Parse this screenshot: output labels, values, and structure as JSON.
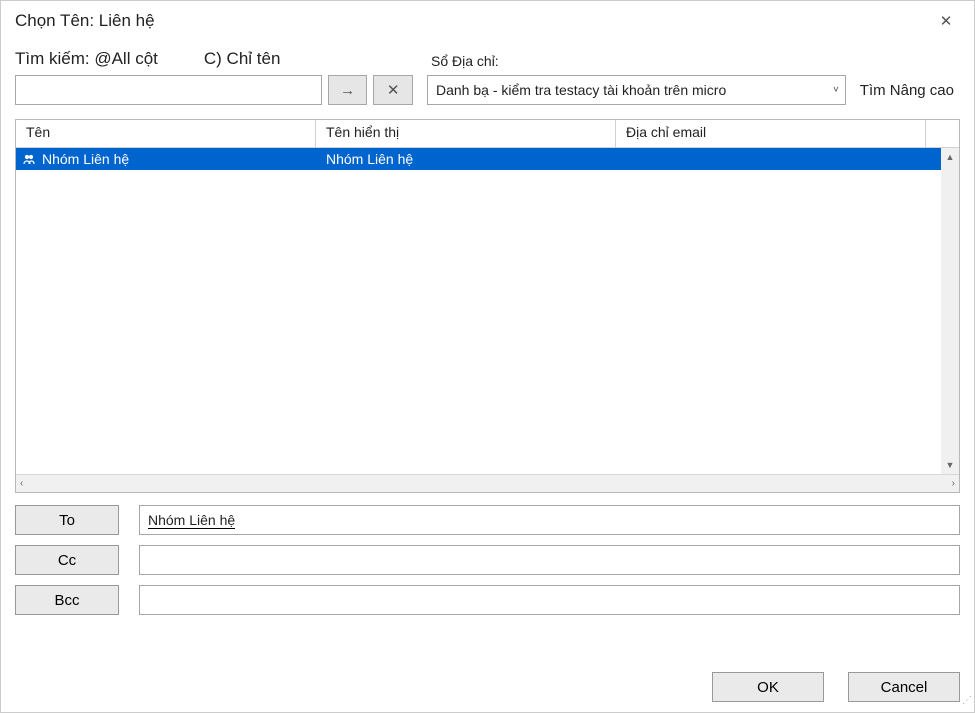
{
  "window": {
    "title": "Chọn Tên: Liên hệ"
  },
  "search": {
    "label_all": "Tìm kiếm: @All cột",
    "label_name_only": "C) Chỉ tên",
    "value": ""
  },
  "arrow_icon": "→",
  "x_icon": "✕",
  "address_book": {
    "label": "Sổ Địa chỉ:",
    "value": "Danh bạ - kiểm tra testacy tài khoản trên micro"
  },
  "advanced_link": "Tìm Nâng cao",
  "columns": {
    "name": "Tên",
    "display_name": "Tên hiển thị",
    "email": "Địa chỉ email"
  },
  "rows": [
    {
      "name": "Nhóm Liên hệ",
      "display_name": "Nhóm Liên hệ",
      "email": ""
    }
  ],
  "recipients": {
    "to_label": "To",
    "to_value": "Nhóm Liên hệ",
    "cc_label": "Cc",
    "cc_value": "",
    "bcc_label": "Bcc",
    "bcc_value": ""
  },
  "buttons": {
    "ok": "OK",
    "cancel": "Cancel"
  },
  "close_icon": "✕",
  "chevron": "˅"
}
